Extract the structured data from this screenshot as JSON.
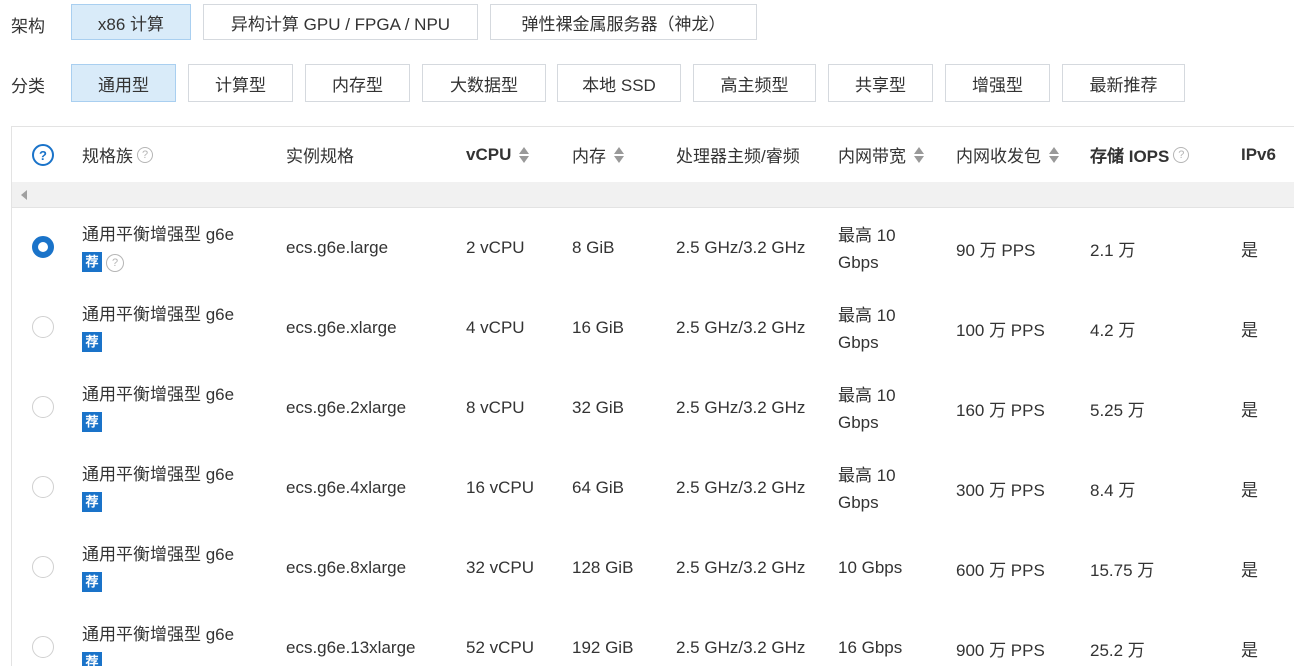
{
  "arch": {
    "label": "架构",
    "options": [
      "x86 计算",
      "异构计算 GPU / FPGA / NPU",
      "弹性裸金属服务器（神龙）"
    ],
    "selected": 0
  },
  "category": {
    "label": "分类",
    "options": [
      "通用型",
      "计算型",
      "内存型",
      "大数据型",
      "本地 SSD",
      "高主频型",
      "共享型",
      "增强型",
      "最新推荐"
    ],
    "selected": 0
  },
  "table": {
    "help_icon": "?",
    "headers": {
      "family": "规格族",
      "spec": "实例规格",
      "vcpu": "vCPU",
      "memory": "内存",
      "freq": "处理器主频/睿频",
      "bandwidth": "内网带宽",
      "pps": "内网收发包",
      "iops": "存储 IOPS",
      "ipv6": "IPv6"
    },
    "tag_label": "荐",
    "rows": [
      {
        "family": "通用平衡增强型 g6e",
        "spec": "ecs.g6e.large",
        "vcpu": "2 vCPU",
        "memory": "8 GiB",
        "freq": "2.5 GHz/3.2 GHz",
        "bw1": "最高 10",
        "bw2": "Gbps",
        "pps": "90 万 PPS",
        "iops": "2.1 万",
        "ipv6": "是",
        "selected": true
      },
      {
        "family": "通用平衡增强型 g6e",
        "spec": "ecs.g6e.xlarge",
        "vcpu": "4 vCPU",
        "memory": "16 GiB",
        "freq": "2.5 GHz/3.2 GHz",
        "bw1": "最高 10",
        "bw2": "Gbps",
        "pps": "100 万 PPS",
        "iops": "4.2 万",
        "ipv6": "是",
        "selected": false
      },
      {
        "family": "通用平衡增强型 g6e",
        "spec": "ecs.g6e.2xlarge",
        "vcpu": "8 vCPU",
        "memory": "32 GiB",
        "freq": "2.5 GHz/3.2 GHz",
        "bw1": "最高 10",
        "bw2": "Gbps",
        "pps": "160 万 PPS",
        "iops": "5.25 万",
        "ipv6": "是",
        "selected": false
      },
      {
        "family": "通用平衡增强型 g6e",
        "spec": "ecs.g6e.4xlarge",
        "vcpu": "16 vCPU",
        "memory": "64 GiB",
        "freq": "2.5 GHz/3.2 GHz",
        "bw1": "最高 10",
        "bw2": "Gbps",
        "pps": "300 万 PPS",
        "iops": "8.4 万",
        "ipv6": "是",
        "selected": false
      },
      {
        "family": "通用平衡增强型 g6e",
        "spec": "ecs.g6e.8xlarge",
        "vcpu": "32 vCPU",
        "memory": "128 GiB",
        "freq": "2.5 GHz/3.2 GHz",
        "bw1": "10 Gbps",
        "bw2": "",
        "pps": "600 万 PPS",
        "iops": "15.75 万",
        "ipv6": "是",
        "selected": false
      },
      {
        "family": "通用平衡增强型 g6e",
        "spec": "ecs.g6e.13xlarge",
        "vcpu": "52 vCPU",
        "memory": "192 GiB",
        "freq": "2.5 GHz/3.2 GHz",
        "bw1": "16 Gbps",
        "bw2": "",
        "pps": "900 万 PPS",
        "iops": "25.2 万",
        "ipv6": "是",
        "selected": false
      }
    ]
  },
  "colors": {
    "accent": "#1a73c9",
    "selected_bg": "#d9ebf9"
  }
}
